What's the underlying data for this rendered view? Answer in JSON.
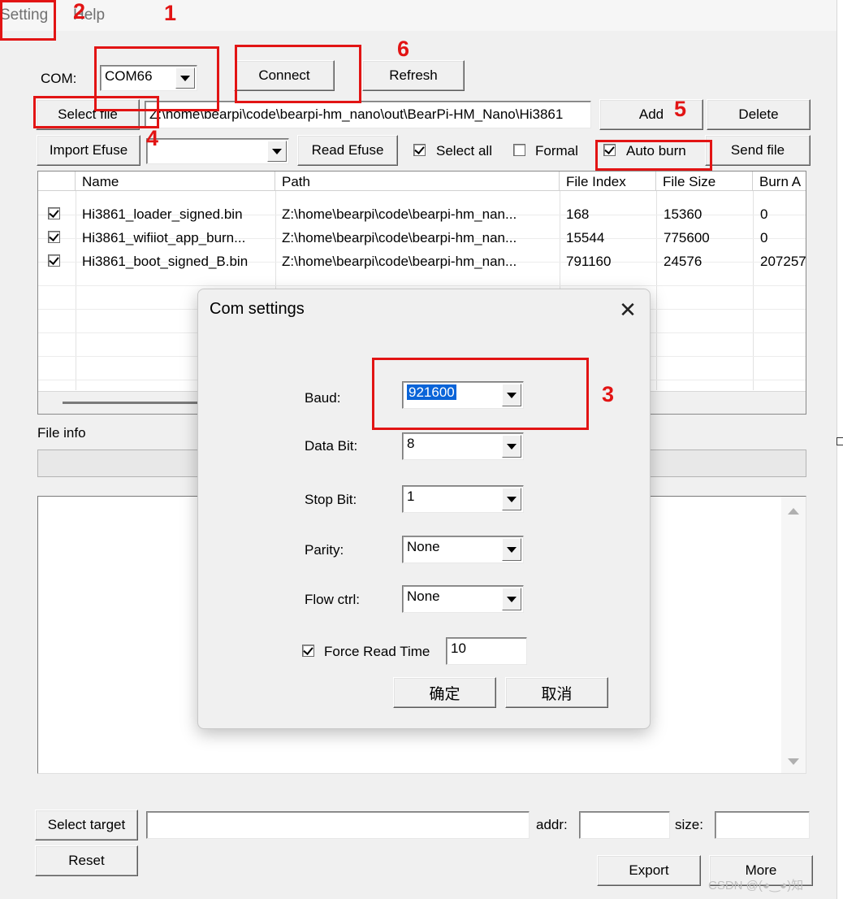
{
  "menu": {
    "setting": "Setting",
    "help": "Help"
  },
  "toolbar": {
    "com_label": "COM:",
    "com_value": "COM66",
    "connect": "Connect",
    "refresh": "Refresh",
    "select_file": "Select file",
    "file_path": "Z:\\home\\bearpi\\code\\bearpi-hm_nano\\out\\BearPi-HM_Nano\\Hi3861",
    "add": "Add",
    "delete": "Delete",
    "import_efuse": "Import Efuse",
    "efuse_value": "",
    "read_efuse": "Read Efuse",
    "select_all": "Select all",
    "formal": "Formal",
    "auto_burn": "Auto burn",
    "send_file": "Send file"
  },
  "table": {
    "columns": [
      "Name",
      "Path",
      "File Index",
      "File Size",
      "Burn A"
    ],
    "rows": [
      {
        "name": "Hi3861_loader_signed.bin",
        "path": "Z:\\home\\bearpi\\code\\bearpi-hm_nan...",
        "index": "168",
        "size": "15360",
        "burn": "0"
      },
      {
        "name": "Hi3861_wifiiot_app_burn...",
        "path": "Z:\\home\\bearpi\\code\\bearpi-hm_nan...",
        "index": "15544",
        "size": "775600",
        "burn": "0"
      },
      {
        "name": "Hi3861_boot_signed_B.bin",
        "path": "Z:\\home\\bearpi\\code\\bearpi-hm_nan...",
        "index": "791160",
        "size": "24576",
        "burn": "207257"
      }
    ]
  },
  "file_info": {
    "label": "File info"
  },
  "bottom": {
    "select_target": "Select target",
    "addr_label": "addr:",
    "size_label": "size:",
    "reset": "Reset",
    "export": "Export",
    "more": "More"
  },
  "watermark": "CSDN @(◕‿◕)知",
  "dialog": {
    "title": "Com settings",
    "baud_label": "Baud:",
    "baud_value": "921600",
    "databit_label": "Data Bit:",
    "databit_value": "8",
    "stopbit_label": "Stop Bit:",
    "stopbit_value": "1",
    "parity_label": "Parity:",
    "parity_value": "None",
    "flowctrl_label": "Flow ctrl:",
    "flowctrl_value": "None",
    "force_read_label": "Force Read Time",
    "force_read_value": "10",
    "ok": "确定",
    "cancel": "取消"
  },
  "annotations": [
    "1",
    "2",
    "3",
    "4",
    "5",
    "6"
  ],
  "colors": {
    "annotation": "#e21414",
    "window_bg": "#f0f0f0",
    "selection": "#0a64d8"
  }
}
